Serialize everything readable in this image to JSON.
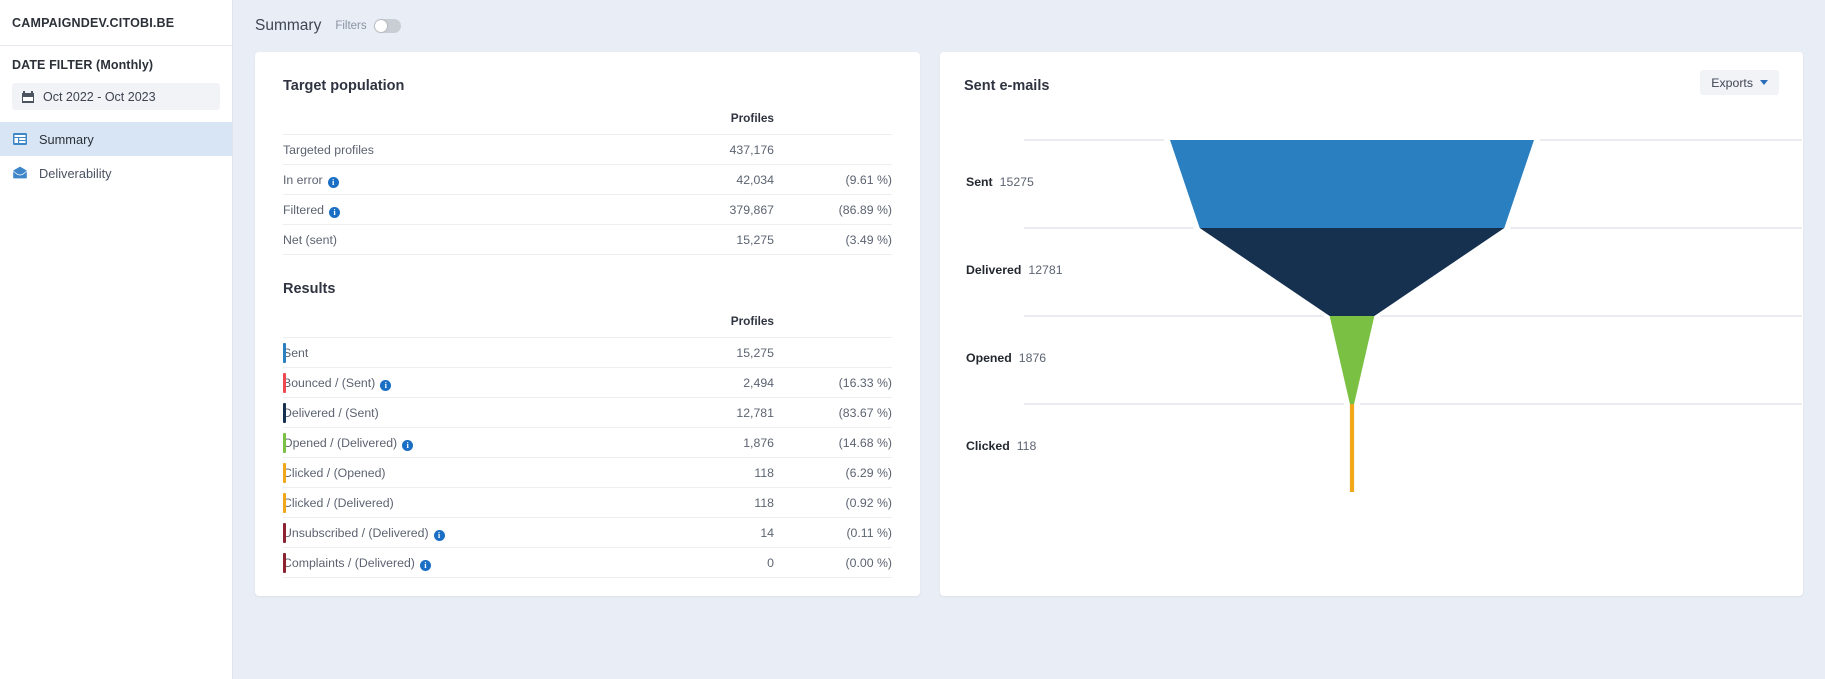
{
  "sidebar": {
    "brand": "CAMPAIGNDEV.CITOBI.BE",
    "filter_title": "DATE FILTER (Monthly)",
    "date_range": "Oct 2022 - Oct 2023",
    "date_icon": "calendar-icon",
    "items": [
      {
        "label": "Summary",
        "icon": "summary-table-icon",
        "active": true
      },
      {
        "label": "Deliverability",
        "icon": "envelope-icon",
        "active": false
      }
    ]
  },
  "topbar": {
    "title": "Summary",
    "filters_label": "Filters",
    "filters_on": false
  },
  "target_population": {
    "title": "Target population",
    "columns": {
      "label": "",
      "profiles": "Profiles",
      "percent": ""
    },
    "rows": [
      {
        "label": "Targeted profiles",
        "info": false,
        "value": "437,176",
        "percent": ""
      },
      {
        "label": "In error",
        "info": true,
        "value": "42,034",
        "percent": "(9.61 %)"
      },
      {
        "label": "Filtered",
        "info": true,
        "value": "379,867",
        "percent": "(86.89 %)"
      },
      {
        "label": "Net (sent)",
        "info": false,
        "value": "15,275",
        "percent": "(3.49 %)"
      }
    ]
  },
  "results": {
    "title": "Results",
    "columns": {
      "label": "",
      "profiles": "Profiles",
      "percent": ""
    },
    "rows": [
      {
        "label": "Sent",
        "info": false,
        "value": "15,275",
        "percent": "",
        "color": "#2a7fc0"
      },
      {
        "label": "Bounced / (Sent)",
        "info": true,
        "value": "2,494",
        "percent": "(16.33 %)",
        "color": "#ef4a52"
      },
      {
        "label": "Delivered / (Sent)",
        "info": false,
        "value": "12,781",
        "percent": "(83.67 %)",
        "color": "#16304f"
      },
      {
        "label": "Opened / (Delivered)",
        "info": true,
        "value": "1,876",
        "percent": "(14.68 %)",
        "color": "#7ac143"
      },
      {
        "label": "Clicked / (Opened)",
        "info": false,
        "value": "118",
        "percent": "(6.29 %)",
        "color": "#f0a71a"
      },
      {
        "label": "Clicked / (Delivered)",
        "info": false,
        "value": "118",
        "percent": "(0.92 %)",
        "color": "#f0a71a"
      },
      {
        "label": "Unsubscribed / (Delivered)",
        "info": true,
        "value": "14",
        "percent": "(0.11 %)",
        "color": "#8e2230"
      },
      {
        "label": "Complaints / (Delivered)",
        "info": true,
        "value": "0",
        "percent": "(0.00 %)",
        "color": "#8e2230"
      }
    ]
  },
  "sent_emails": {
    "title": "Sent e-mails",
    "exports_label": "Exports",
    "exports_icon": "chevron-down-icon"
  },
  "chart_data": {
    "type": "funnel",
    "title": "Sent e-mails",
    "categories": [
      "Sent",
      "Delivered",
      "Opened",
      "Clicked"
    ],
    "values": [
      15275,
      12781,
      1876,
      118
    ],
    "value_labels": [
      "15275",
      "12781",
      "1876",
      "118"
    ],
    "colors": [
      "#2a7fc0",
      "#16304f",
      "#7ac143",
      "#f0a71a"
    ],
    "legend": "left-labels",
    "grid": true,
    "ylabel": "",
    "xlabel": ""
  }
}
